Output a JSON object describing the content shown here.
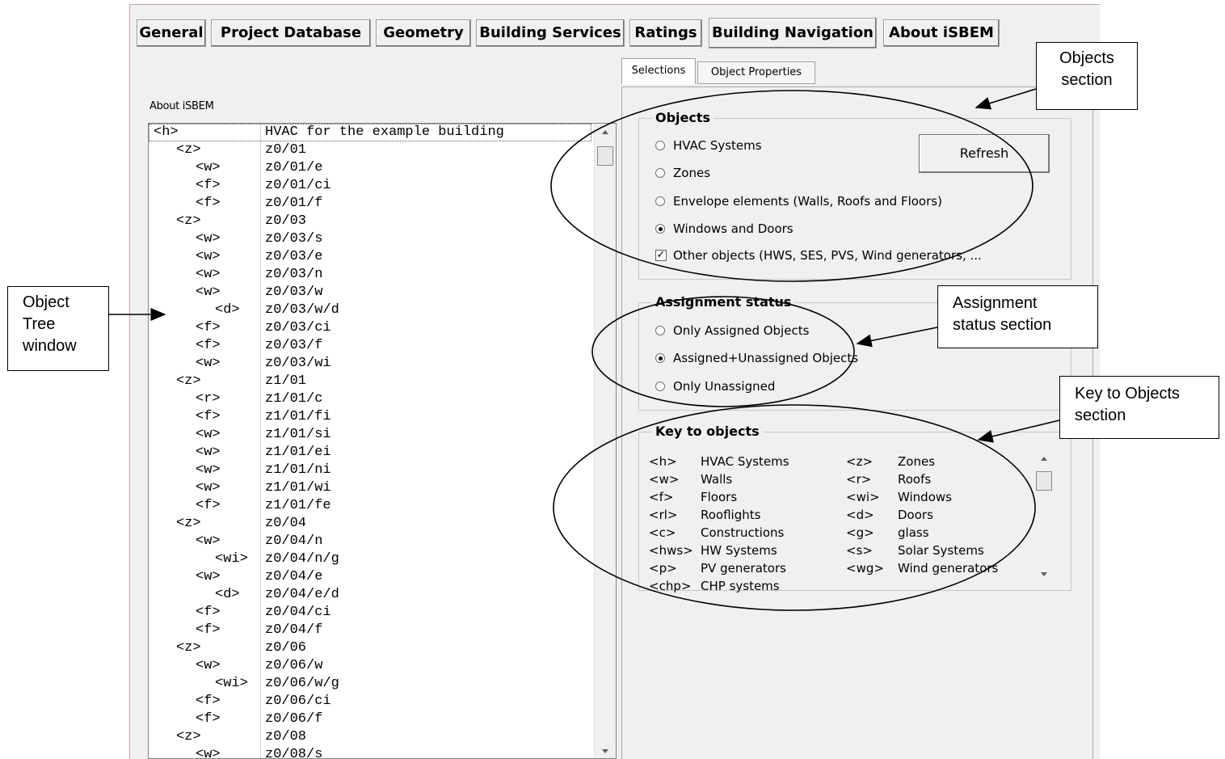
{
  "tabs": [
    {
      "label": "General"
    },
    {
      "label": "Project Database"
    },
    {
      "label": "Geometry"
    },
    {
      "label": "Building Services"
    },
    {
      "label": "Ratings"
    },
    {
      "label": "Building Navigation"
    },
    {
      "label": "About iSBEM"
    }
  ],
  "subtabs": [
    {
      "label": "Selections"
    },
    {
      "label": "Object Properties"
    }
  ],
  "tree": {
    "label": "About iSBEM",
    "rows": [
      {
        "key": "<h>",
        "value": "HVAC for the example building"
      },
      {
        "key": "<z>",
        "value": "z0/01"
      },
      {
        "key": "<w>",
        "value": "z0/01/e"
      },
      {
        "key": "<f>",
        "value": "z0/01/ci"
      },
      {
        "key": "<f>",
        "value": "z0/01/f"
      },
      {
        "key": "<z>",
        "value": "z0/03"
      },
      {
        "key": "<w>",
        "value": "z0/03/s"
      },
      {
        "key": "<w>",
        "value": "z0/03/e"
      },
      {
        "key": "<w>",
        "value": "z0/03/n"
      },
      {
        "key": "<w>",
        "value": "z0/03/w"
      },
      {
        "key": "<d>",
        "value": "z0/03/w/d"
      },
      {
        "key": "<f>",
        "value": "z0/03/ci"
      },
      {
        "key": "<f>",
        "value": "z0/03/f"
      },
      {
        "key": "<w>",
        "value": "z0/03/wi"
      },
      {
        "key": "<z>",
        "value": "z1/01"
      },
      {
        "key": "<r>",
        "value": "z1/01/c"
      },
      {
        "key": "<f>",
        "value": "z1/01/fi"
      },
      {
        "key": "<w>",
        "value": "z1/01/si"
      },
      {
        "key": "<w>",
        "value": "z1/01/ei"
      },
      {
        "key": "<w>",
        "value": "z1/01/ni"
      },
      {
        "key": "<w>",
        "value": "z1/01/wi"
      },
      {
        "key": "<f>",
        "value": "z1/01/fe"
      },
      {
        "key": "<z>",
        "value": "z0/04"
      },
      {
        "key": "<w>",
        "value": "z0/04/n"
      },
      {
        "key": "<wi>",
        "value": "z0/04/n/g"
      },
      {
        "key": "<w>",
        "value": "z0/04/e"
      },
      {
        "key": "<d>",
        "value": "z0/04/e/d"
      },
      {
        "key": "<f>",
        "value": "z0/04/ci"
      },
      {
        "key": "<f>",
        "value": "z0/04/f"
      },
      {
        "key": "<z>",
        "value": "z0/06"
      },
      {
        "key": "<w>",
        "value": "z0/06/w"
      },
      {
        "key": "<wi>",
        "value": "z0/06/w/g"
      },
      {
        "key": "<f>",
        "value": "z0/06/ci"
      },
      {
        "key": "<f>",
        "value": "z0/06/f"
      },
      {
        "key": "<z>",
        "value": "z0/08"
      },
      {
        "key": "<w>",
        "value": "z0/08/s"
      }
    ]
  },
  "objects": {
    "title": "Objects",
    "refresh_label": "Refresh",
    "options": [
      {
        "label": "HVAC Systems",
        "selected": false
      },
      {
        "label": "Zones",
        "selected": false
      },
      {
        "label": "Envelope elements (Walls, Roofs and Floors)",
        "selected": false
      },
      {
        "label": "Windows and Doors",
        "selected": true
      }
    ],
    "other_checkbox": {
      "label": "Other objects (HWS, SES, PVS, Wind generators, ...",
      "checked": true
    }
  },
  "assignment": {
    "title": "Assignment status",
    "options": [
      {
        "label": "Only Assigned Objects",
        "selected": false
      },
      {
        "label": "Assigned+Unassigned Objects",
        "selected": true
      },
      {
        "label": "Only Unassigned",
        "selected": false
      }
    ]
  },
  "key": {
    "title": "Key to objects",
    "rows": [
      {
        "k1": "<h>",
        "v1": "HVAC Systems",
        "k2": "<z>",
        "v2": "Zones"
      },
      {
        "k1": "<w>",
        "v1": "Walls",
        "k2": "<r>",
        "v2": "Roofs"
      },
      {
        "k1": "<f>",
        "v1": "Floors",
        "k2": "<wi>",
        "v2": "Windows"
      },
      {
        "k1": "<rl>",
        "v1": "Rooflights",
        "k2": "<d>",
        "v2": "Doors"
      },
      {
        "k1": "<c>",
        "v1": "Constructions",
        "k2": "<g>",
        "v2": "glass"
      },
      {
        "k1": "<hws>",
        "v1": "HW Systems",
        "k2": "<s>",
        "v2": "Solar Systems"
      },
      {
        "k1": "<p>",
        "v1": "PV generators",
        "k2": "<wg>",
        "v2": "Wind generators"
      },
      {
        "k1": "<chp>",
        "v1": "CHP systems",
        "k2": "",
        "v2": ""
      }
    ]
  },
  "callouts": {
    "objects_section": "Objects\nsection",
    "object_tree": "Object\nTree\nwindow",
    "assignment_section": "Assignment\nstatus section",
    "key_section": "Key to Objects\nsection"
  }
}
